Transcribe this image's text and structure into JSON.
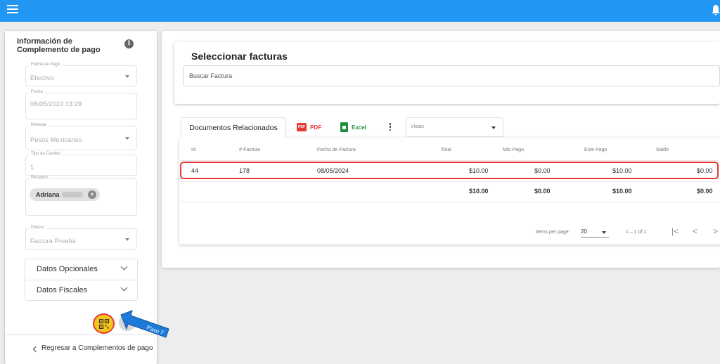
{
  "colors": {
    "topbar": "#2196f3",
    "highlight": "#e53935",
    "qr_button": "#f5c518",
    "pdf": "#e53935",
    "excel": "#1e8e3e",
    "annotation_arrow": "#1e7ad8"
  },
  "topbar": {
    "menu_icon": "hamburger-menu-icon",
    "bell_icon": "notification-bell-icon"
  },
  "sidebar": {
    "title": "Información de Complemento de pago",
    "info_icon": "i",
    "fields": {
      "forma_pago": {
        "label": "Forma de Pago",
        "value": "Efectivo"
      },
      "fecha": {
        "label": "Fecha",
        "value": "08/05/2024 13:29"
      },
      "moneda": {
        "label": "Moneda",
        "value": "Pesos Mexicanos"
      },
      "tipo_cambio": {
        "label": "Tipo de Cambio",
        "value": "1"
      },
      "receptor": {
        "label": "Receptor",
        "chip": "Adriana",
        "chip_remove_icon": "×"
      },
      "emisor": {
        "label": "Emisor",
        "value": "Factura Prueba"
      }
    },
    "accordion": [
      {
        "label": "Datos Opcionales"
      },
      {
        "label": "Datos Fiscales"
      }
    ],
    "back_link": "Regresar a Complementos de pago"
  },
  "annotation": {
    "label": "Paso 7"
  },
  "search_card": {
    "title": "Seleccionar facturas",
    "placeholder": "Buscar Factura"
  },
  "toolbar": {
    "tab": "Documentos Relacionados",
    "pdf_icon": "PDF",
    "pdf_label": "PDF",
    "excel_label": "Excel",
    "views_label": "Vistas"
  },
  "table": {
    "headers": {
      "id": "Id",
      "factura": "#-Factura",
      "fecha": "Fecha de Factura",
      "total": "Total",
      "mto_pago": "Mto Pago.",
      "este_pago": "Este Pago",
      "saldo": "Saldo"
    },
    "rows": [
      {
        "id": "44",
        "factura": "178",
        "fecha": "08/05/2024",
        "total": "$10.00",
        "mto_pago": "$0.00",
        "este_pago": "$10.00",
        "saldo": "$0.00"
      }
    ],
    "totals": {
      "total": "$10.00",
      "mto_pago": "$0.00",
      "este_pago": "$10.00",
      "saldo": "$0.00"
    }
  },
  "paginator": {
    "items_label": "Items per page:",
    "page_size": "20",
    "range": "1 – 1 of 1",
    "first": "|<",
    "prev": "<",
    "next": ">"
  }
}
